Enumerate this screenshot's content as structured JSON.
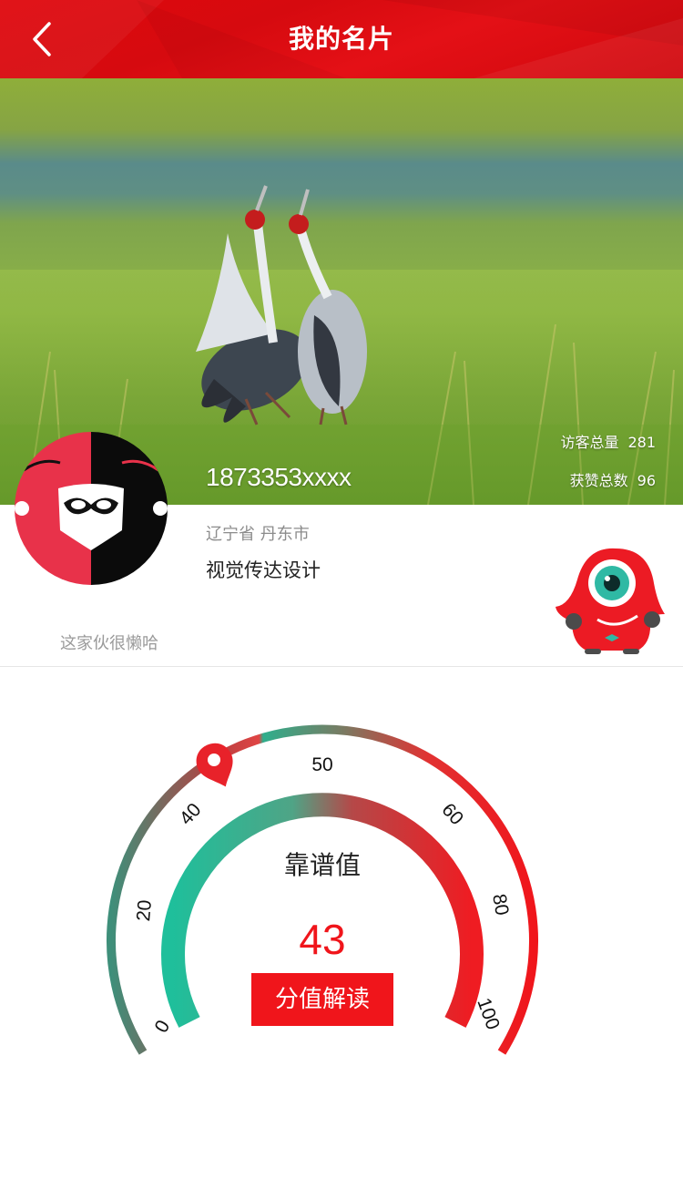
{
  "header": {
    "title": "我的名片",
    "back_icon": "chevron-left-icon"
  },
  "profile": {
    "phone": "1873353xxxx",
    "location": "辽宁省 丹东市",
    "profession": "视觉传达设计",
    "signature": "这家伙很懒哈",
    "stats": [
      {
        "label": "访客总量",
        "value": "281"
      },
      {
        "label": "获赞总数",
        "value": "96"
      }
    ]
  },
  "score": {
    "title": "靠谱值",
    "value": 43,
    "button_label": "分值解读",
    "scale_labels": [
      "0",
      "20",
      "40",
      "50",
      "60",
      "80",
      "100"
    ],
    "marker_icon": "location-pin-icon"
  },
  "colors": {
    "brand_red": "#e0080d",
    "score_red": "#f0151b",
    "gauge_teal": "#1fbf9b"
  }
}
